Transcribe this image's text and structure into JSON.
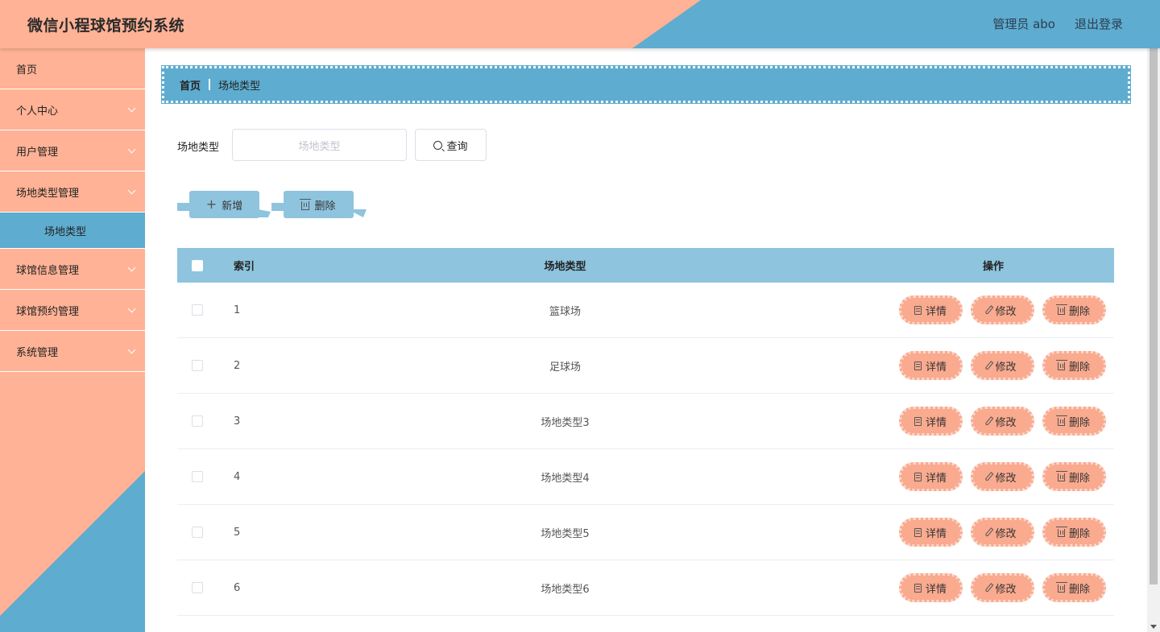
{
  "header": {
    "title": "微信小程球馆预约系统",
    "user": "管理员 abo",
    "logout": "退出登录"
  },
  "sidebar": {
    "items": [
      {
        "label": "首页",
        "expandable": false
      },
      {
        "label": "个人中心",
        "expandable": true
      },
      {
        "label": "用户管理",
        "expandable": true
      },
      {
        "label": "场地类型管理",
        "expandable": true,
        "children": [
          "场地类型"
        ]
      },
      {
        "label": "球馆信息管理",
        "expandable": true
      },
      {
        "label": "球馆预约管理",
        "expandable": true
      },
      {
        "label": "系统管理",
        "expandable": true
      }
    ]
  },
  "breadcrumb": {
    "home": "首页",
    "current": "场地类型"
  },
  "search": {
    "label": "场地类型",
    "placeholder": "场地类型",
    "button": "查询"
  },
  "actions": {
    "add": "新增",
    "delete": "删除"
  },
  "table": {
    "headers": {
      "index": "索引",
      "type": "场地类型",
      "ops": "操作"
    },
    "rows": [
      {
        "index": "1",
        "type": "篮球场"
      },
      {
        "index": "2",
        "type": "足球场"
      },
      {
        "index": "3",
        "type": "场地类型3"
      },
      {
        "index": "4",
        "type": "场地类型4"
      },
      {
        "index": "5",
        "type": "场地类型5"
      },
      {
        "index": "6",
        "type": "场地类型6"
      }
    ],
    "row_ops": {
      "detail": "详情",
      "edit": "修改",
      "delete": "删除"
    }
  },
  "icons": {
    "search": "search-icon",
    "add": "plus-icon",
    "delete": "trash-icon",
    "detail": "document-icon",
    "edit": "pencil-icon",
    "expand": "chevron-down-icon"
  },
  "colors": {
    "peach": "#ffb295",
    "blue": "#5eaccf",
    "light_blue": "#8ec4de",
    "op_button": "#f9aa8f"
  }
}
